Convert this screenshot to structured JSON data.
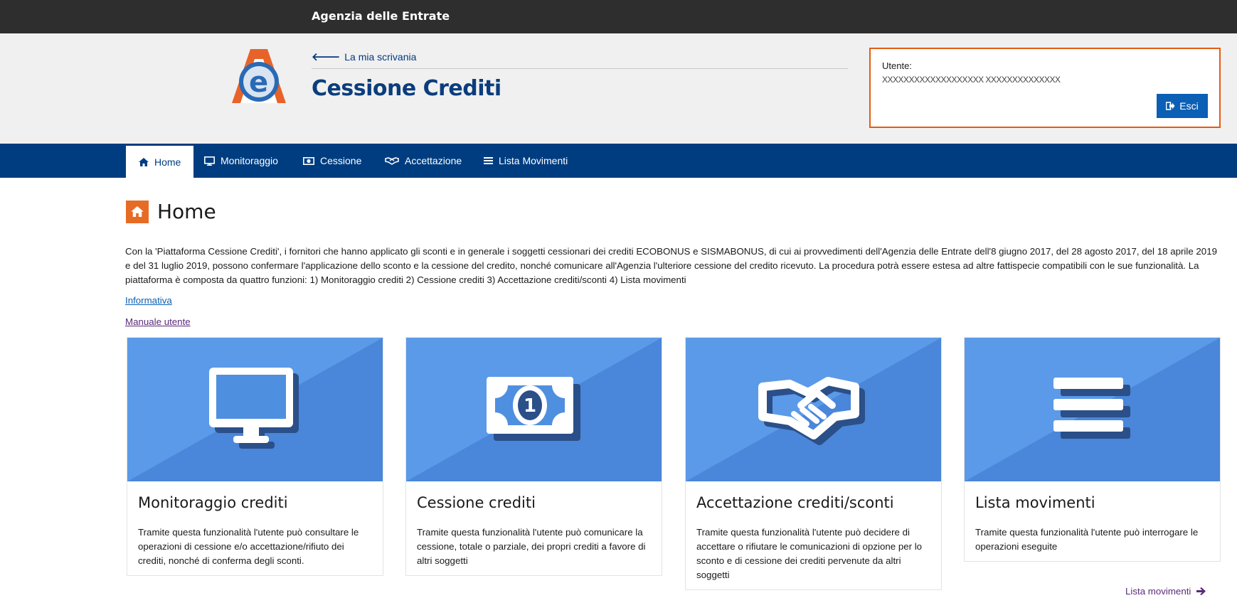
{
  "topbar": {
    "brand": "Agenzia delle Entrate"
  },
  "header": {
    "back_link": "La mia scrivania",
    "title": "Cessione Crediti",
    "user_label": "Utente:",
    "user_name": "XXXXXXXXXXXXXXXXXXX XXXXXXXXXXXXXX",
    "logout_label": "Esci"
  },
  "nav": {
    "items": [
      {
        "label": "Home",
        "icon": "home-icon"
      },
      {
        "label": "Monitoraggio",
        "icon": "monitor-icon"
      },
      {
        "label": "Cessione",
        "icon": "banknote-icon"
      },
      {
        "label": "Accettazione",
        "icon": "handshake-icon"
      },
      {
        "label": "Lista Movimenti",
        "icon": "list-icon"
      }
    ]
  },
  "page": {
    "title": "Home",
    "intro": "Con la 'Piattaforma Cessione Crediti', i fornitori che hanno applicato gli sconti e in generale i soggetti cessionari dei crediti ECOBONUS e SISMABONUS, di cui ai provvedimenti dell'Agenzia delle Entrate dell'8 giugno 2017, del 28 agosto 2017, del 18 aprile 2019 e del 31 luglio 2019, possono confermare l'applicazione dello sconto e la cessione del credito, nonché comunicare all'Agenzia l'ulteriore cessione del credito ricevuto. La procedura potrà essere estesa ad altre fattispecie compatibili con le sue funzionalità. La piattaforma è composta da quattro funzioni: 1) Monitoraggio crediti 2) Cessione crediti 3) Accettazione crediti/sconti 4) Lista movimenti",
    "link_informativa": "Informativa",
    "link_manuale": "Manuale utente"
  },
  "cards": [
    {
      "title": "Monitoraggio crediti",
      "text": "Tramite questa funzionalità l'utente può consultare le operazioni di cessione e/o accettazione/rifiuto dei crediti, nonché di conferma degli sconti.",
      "icon": "monitor-icon"
    },
    {
      "title": "Cessione crediti",
      "text": "Tramite questa funzionalità l'utente può comunicare la cessione, totale o parziale, dei propri crediti a favore di altri soggetti",
      "icon": "banknote-icon"
    },
    {
      "title": "Accettazione crediti/sconti",
      "text": "Tramite questa funzionalità l'utente può decidere di accettare o rifiutare le comunicazioni di opzione per lo sconto e di cessione dei crediti pervenute da altri soggetti",
      "icon": "handshake-icon"
    },
    {
      "title": "Lista movimenti",
      "text": "Tramite questa funzionalità l'utente può interrogare le operazioni eseguite",
      "icon": "list-icon",
      "link": "Lista movimenti"
    }
  ],
  "colors": {
    "nav": "#003d80",
    "accent": "#e66b25",
    "card_art": "#4f8fe0",
    "button": "#0b5fb4"
  }
}
